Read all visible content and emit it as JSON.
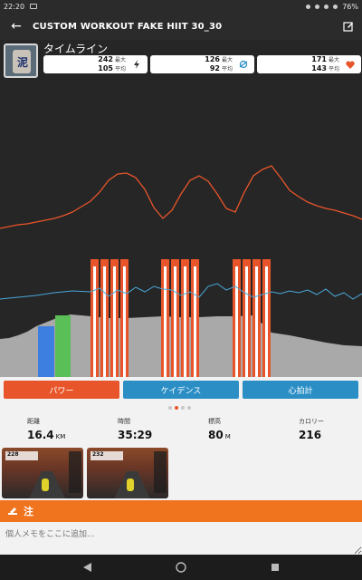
{
  "status_bar": {
    "time": "22:20",
    "battery": "76%"
  },
  "appbar": {
    "title": "CUSTOM WORKOUT FAKE HIIT 30_30"
  },
  "timeline": {
    "label": "タイムライン"
  },
  "stats": [
    {
      "max": "242",
      "max_label": "最大",
      "avg": "105",
      "avg_label": "平均",
      "icon": "lightning-icon",
      "color": "#333333"
    },
    {
      "max": "126",
      "max_label": "最大",
      "avg": "92",
      "avg_label": "平均",
      "icon": "cadence-icon",
      "color": "#2b8fc6"
    },
    {
      "max": "171",
      "max_label": "最大",
      "avg": "143",
      "avg_label": "平均",
      "icon": "heart-icon",
      "color": "#e8552a"
    }
  ],
  "tabs": {
    "power": "パワー",
    "cadence": "ケイデンス",
    "heart_rate": "心拍計"
  },
  "metrics": [
    {
      "label": "距離",
      "value": "16.4",
      "unit": "KM"
    },
    {
      "label": "時間",
      "value": "35:29",
      "unit": ""
    },
    {
      "label": "標高",
      "value": "80",
      "unit": "M"
    },
    {
      "label": "カロリー",
      "value": "216",
      "unit": ""
    }
  ],
  "thumbnails": [
    {
      "hud": "228"
    },
    {
      "hud": "232"
    }
  ],
  "notes": {
    "title": "注",
    "placeholder": "個人メモをここに追加..."
  },
  "colors": {
    "power": "#e8552a",
    "cadence": "#4aa8d8",
    "elevation": "#a8a8a8",
    "accent": "#f0731e"
  }
}
